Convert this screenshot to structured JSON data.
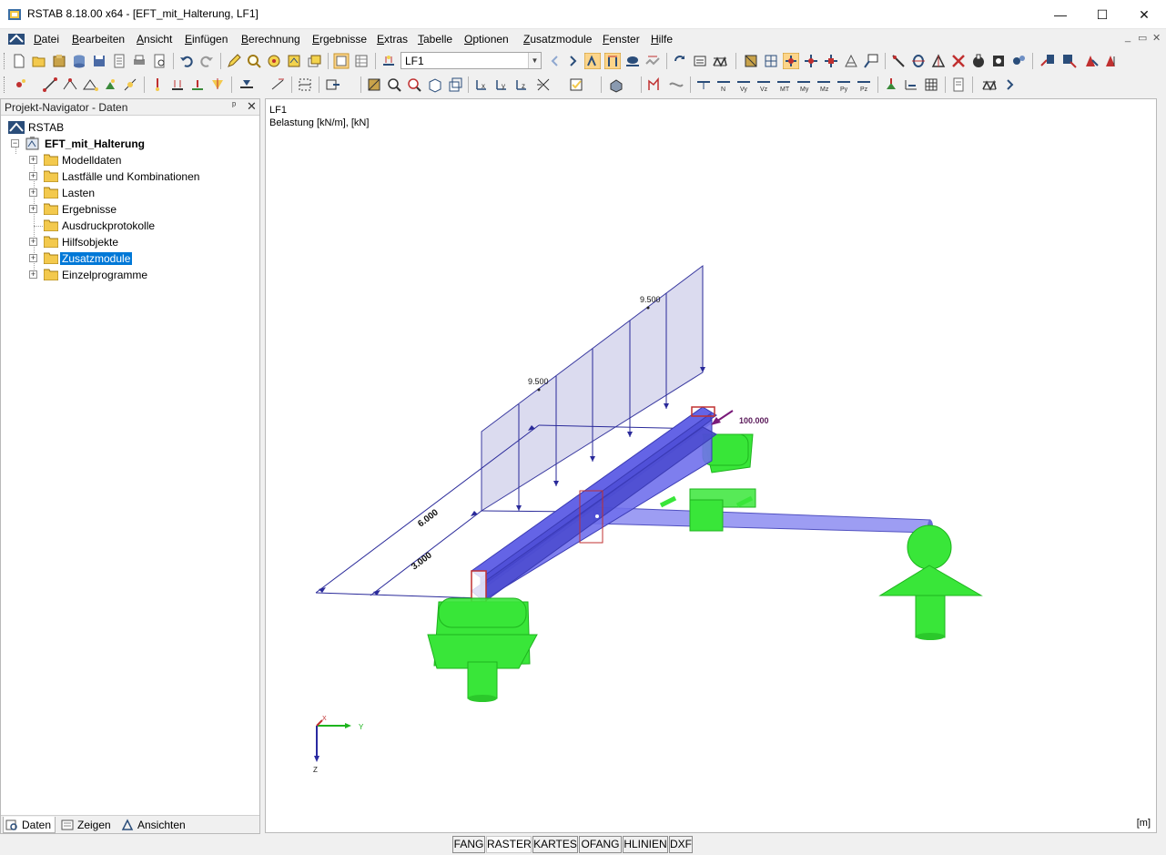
{
  "window": {
    "title": "RSTAB 8.18.00 x64 - [EFT_mit_Halterung, LF1]",
    "minimize": "—",
    "maximize": "☐",
    "close": "✕"
  },
  "menu": {
    "items": [
      "Datei",
      "Bearbeiten",
      "Ansicht",
      "Einfügen",
      "Berechnung",
      "Ergebnisse",
      "Extras",
      "Tabelle",
      "Optionen",
      "Zusatzmodule",
      "Fenster",
      "Hilfe"
    ],
    "mdi_controls": [
      "_",
      "▭",
      "✕"
    ]
  },
  "toolbar": {
    "load_case_value": "LF1",
    "load_case_dropdown_icon": "chevron-down-icon"
  },
  "navigator": {
    "title": "Projekt-Navigator - Daten",
    "pin": "ᵖ",
    "close": "✕",
    "root": "RSTAB",
    "project": "EFT_mit_Halterung",
    "folders": [
      "Modelldaten",
      "Lastfälle und Kombinationen",
      "Lasten",
      "Ergebnisse",
      "Ausdruckprotokolle",
      "Hilfsobjekte",
      "Zusatzmodule",
      "Einzelprogramme"
    ],
    "selected": "Zusatzmodule",
    "tabs": [
      "Daten",
      "Zeigen",
      "Ansichten"
    ],
    "active_tab": "Daten"
  },
  "viewport": {
    "load_case": "LF1",
    "info": "Belastung [kN/m], [kN]",
    "unit": "[m]",
    "labels": {
      "load_left": "9.500",
      "load_right": "9.500",
      "point_load": "100.000",
      "dim_outer": "6.000",
      "dim_inner": "3.000",
      "axis_x": "X",
      "axis_y": "Y",
      "axis_z": "Z"
    },
    "colors": {
      "support": "#39e639",
      "member": "#5c5ce6",
      "load": "#7272c8",
      "point_load": "#7a1a7a"
    }
  },
  "statusbar": {
    "buttons": [
      "FANG",
      "RASTER",
      "KARTES",
      "OFANG",
      "HLINIEN",
      "DXF"
    ],
    "active": [
      "RASTER"
    ]
  }
}
